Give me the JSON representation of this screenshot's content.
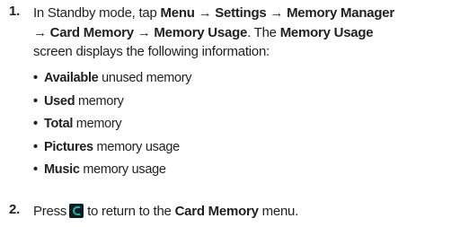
{
  "step1": {
    "number": "1.",
    "intro": "In Standby mode, tap ",
    "path_1": "Menu",
    "arrow_1": " → ",
    "path_2": "Settings",
    "arrow_2": " → ",
    "path_3": "Memory Manager",
    "arrow_3": "→ ",
    "path_4": "Card Memory",
    "arrow_4": " → ",
    "path_5": "Memory Usage",
    "mid_text": ". The ",
    "screen_name": "Memory Usage",
    "end_text": "screen displays the following information:",
    "bullet_char": "•",
    "bullets": [
      {
        "bold": "Available",
        "rest": " unused memory"
      },
      {
        "bold": "Used",
        "rest": " memory"
      },
      {
        "bold": "Total",
        "rest": " memory"
      },
      {
        "bold": "Pictures",
        "rest": " memory usage"
      },
      {
        "bold": "Music",
        "rest": " memory usage"
      }
    ]
  },
  "step2": {
    "number": "2.",
    "press": "Press",
    "icon": "end-key-icon",
    "after_icon": "to return to the ",
    "menu_name": "Card Memory",
    "end": " menu."
  },
  "colors": {
    "text": "#231f20",
    "key_bg": "#0f1e24",
    "key_accent": "#2ab0a8"
  }
}
